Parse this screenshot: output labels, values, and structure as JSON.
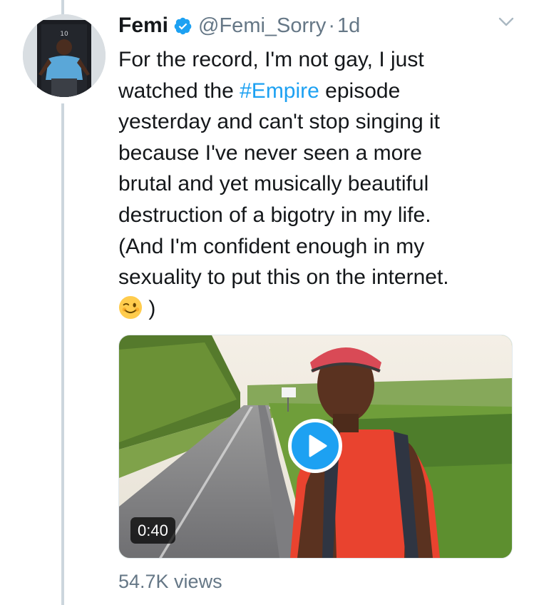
{
  "tweet": {
    "author_name": "Femi",
    "handle": "@Femi_Sorry",
    "separator": "·",
    "time": "1d",
    "text_lines": {
      "l1": "For the record, I'm not gay, I just",
      "l2_before": "watched the ",
      "l2_hashtag": "#Empire",
      "l2_after": " episode",
      "l3": "yesterday and can't stop singing it",
      "l4": "because I've never seen a more",
      "l5": "brutal and yet musically beautiful",
      "l6": "destruction of a bigotry in my life.",
      "l7": "(And I'm confident enough in my",
      "l8": "sexuality to put this on the internet.",
      "l9_after_emoji": " )"
    },
    "video": {
      "duration": "0:40",
      "play_icon": "play-icon"
    },
    "views": "54.7K views"
  },
  "icons": {
    "verified": "verified-badge-icon",
    "menu": "chevron-down-icon",
    "emoji": "winking-face-emoji"
  },
  "colors": {
    "accent": "#1da1f2",
    "secondary_text": "#657786",
    "primary_text": "#14171a"
  }
}
